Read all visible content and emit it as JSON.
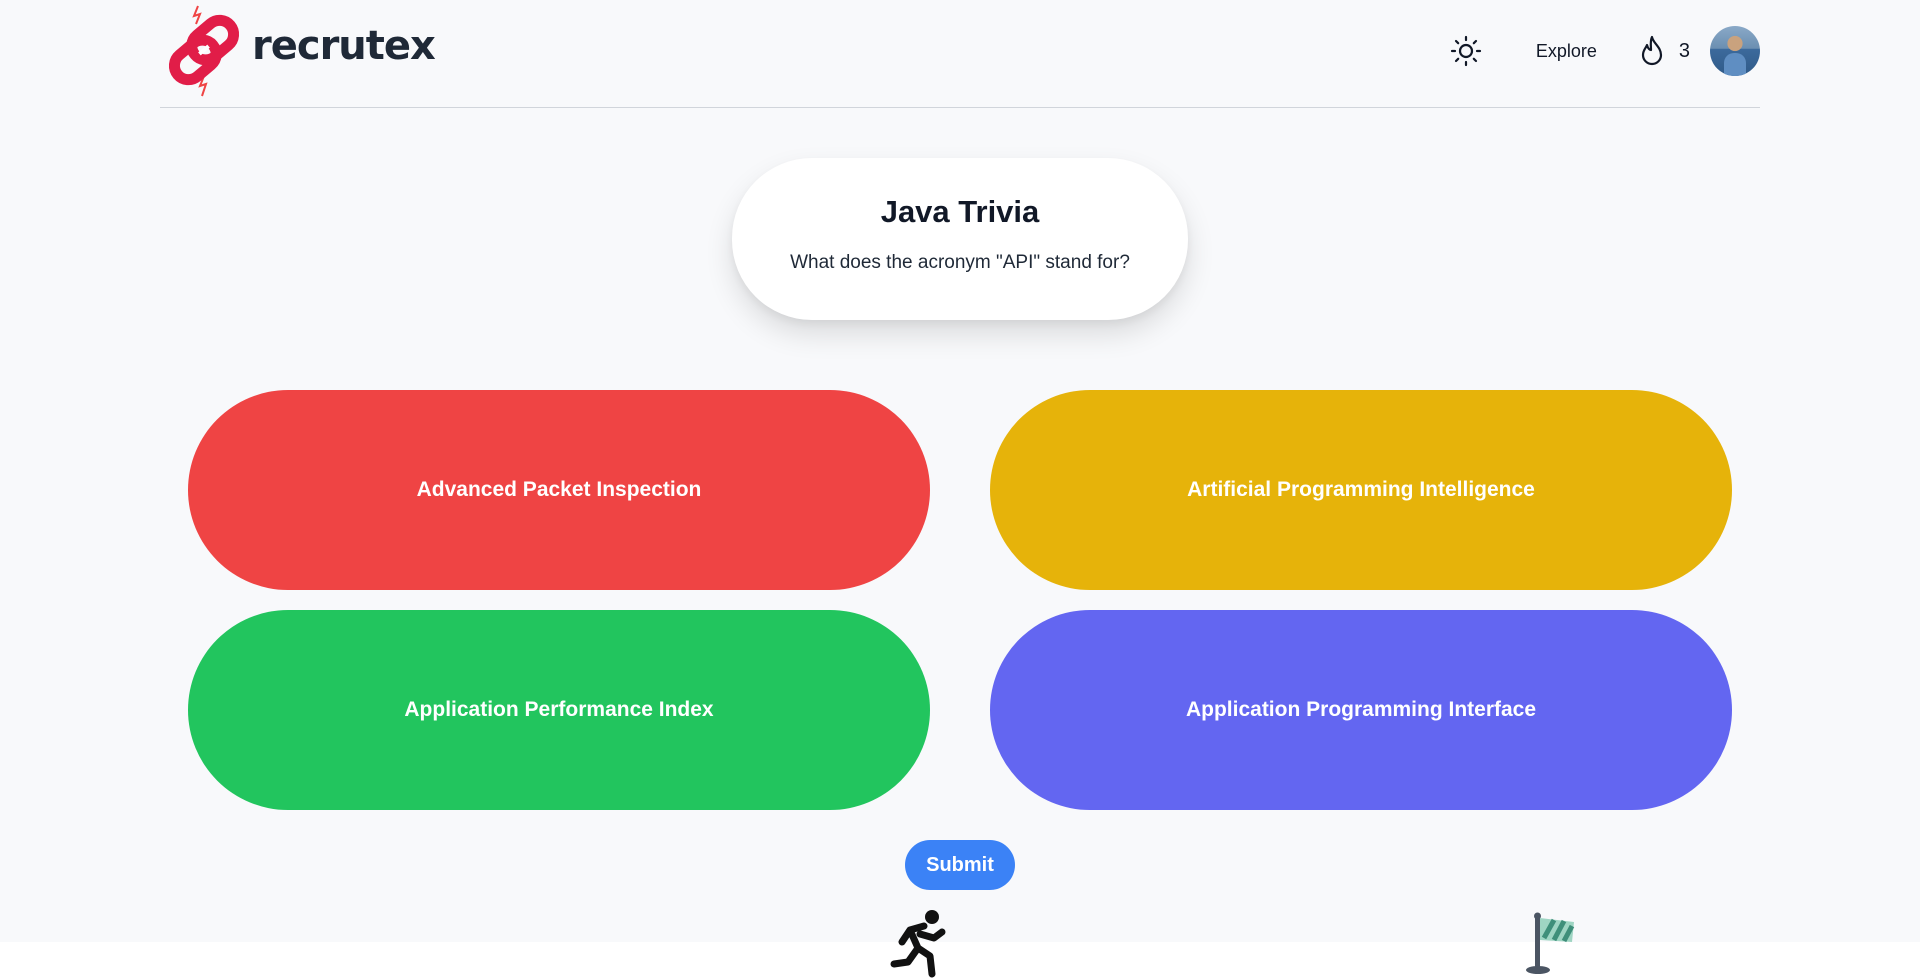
{
  "header": {
    "brand": "recrutex",
    "nav": {
      "explore_label": "Explore",
      "streak_count": "3"
    },
    "icons": {
      "theme_toggle": "sun-icon",
      "streak": "fire-icon",
      "profile": "avatar"
    }
  },
  "quiz": {
    "title": "Java Trivia",
    "question": "What does the acronym \"API\" stand for?"
  },
  "answers": [
    {
      "label": "Advanced Packet Inspection",
      "color": "#ef4444"
    },
    {
      "label": "Artificial Programming Intelligence",
      "color": "#e6b30a"
    },
    {
      "label": "Application Performance Index",
      "color": "#22c55e"
    },
    {
      "label": "Application Programming Interface",
      "color": "#6366f1"
    }
  ],
  "submit_label": "Submit",
  "progress": {
    "icons": [
      "running-person-icon",
      "finish-flag-icon"
    ]
  },
  "colors": {
    "brand_red": "#e11d48",
    "submit_blue": "#3b82f6",
    "background": "#f8f9fb"
  }
}
